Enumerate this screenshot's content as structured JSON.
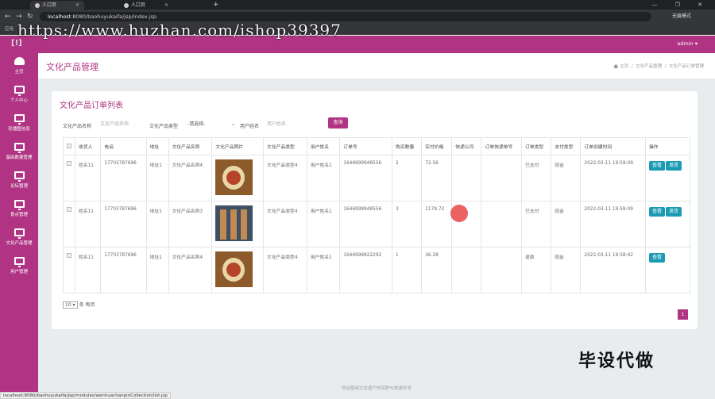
{
  "browser": {
    "tabs": [
      {
        "title": "人口页"
      },
      {
        "title": "人口页"
      }
    ],
    "url_host": "localhost",
    "url_rest": ":8080/baohuyukaifa/jsp/index.jsp",
    "profile": "无痕模式",
    "window_controls": "— ❐ ✕",
    "bookmarks": [
      "应用",
      "",
      "",
      "",
      ""
    ]
  },
  "watermark": "https://www.huzhan.com/ishop39397",
  "app": {
    "logo": "[!]",
    "user": "admin ▾"
  },
  "sidebar": {
    "items": [
      {
        "label": "主页",
        "icon": "gauge-icon"
      },
      {
        "label": "个人中心",
        "icon": "monitor-icon"
      },
      {
        "label": "轮播图信息",
        "icon": "monitor-icon"
      },
      {
        "label": "基础数据管理",
        "icon": "monitor-icon"
      },
      {
        "label": "论坛管理",
        "icon": "monitor-icon"
      },
      {
        "label": "景点管理",
        "icon": "monitor-icon"
      },
      {
        "label": "文化产品管理",
        "icon": "monitor-icon"
      },
      {
        "label": "用户管理",
        "icon": "monitor-icon"
      }
    ]
  },
  "page": {
    "title": "文化产品管理",
    "breadcrumb": [
      "主页",
      "文化产品管理",
      "文化产品订单管理"
    ]
  },
  "card": {
    "title": "文化产品订单列表",
    "filters": {
      "name_label": "文化产品名称",
      "name_placeholder": "文化产品名称",
      "type_label": "文化产品类型",
      "type_value": "-请选择-",
      "user_label": "用户姓名",
      "user_placeholder": "用户姓名",
      "search_button": "查询"
    },
    "table": {
      "headers": [
        "",
        "收货人",
        "电话",
        "地址",
        "文化产品名称",
        "文化产品照片",
        "文化产品类型",
        "用户姓名",
        "订单号",
        "购买数量",
        "实付价格",
        "快递公司",
        "订单快递单号",
        "订单类型",
        "支付类型",
        "订单创建时间",
        "操作"
      ],
      "rows": [
        {
          "receiver": "姓名11",
          "phone": "17703787696",
          "address": "地址1",
          "product": "文化产品名称4",
          "photo": "medal",
          "type": "文化产品类型4",
          "user": "用户姓名1",
          "order_no": "1646999948556",
          "qty": "2",
          "price": "72.56",
          "courier": "",
          "tracking": "",
          "order_type": "已支付",
          "pay_type": "现金",
          "created": "2022-03-11 19:59:09",
          "actions": [
            "查看",
            "发货"
          ]
        },
        {
          "receiver": "姓名11",
          "phone": "17703787696",
          "address": "地址1",
          "product": "文化产品名称3",
          "photo": "sticks",
          "type": "文化产品类型4",
          "user": "用户姓名1",
          "order_no": "1646999948556",
          "qty": "3",
          "price": "1179.72",
          "courier": "",
          "tracking": "",
          "order_type": "已支付",
          "pay_type": "现金",
          "created": "2022-03-11 19:59:09",
          "actions": [
            "查看",
            "发货"
          ]
        },
        {
          "receiver": "姓名11",
          "phone": "17703787696",
          "address": "地址1",
          "product": "文化产品名称4",
          "photo": "medal",
          "type": "文化产品类型4",
          "user": "用户姓名1",
          "order_no": "1646999922292",
          "qty": "1",
          "price": "36.28",
          "courier": "",
          "tracking": "",
          "order_type": "退款",
          "pay_type": "现金",
          "created": "2022-03-11 19:58:42",
          "actions": [
            "查看"
          ]
        }
      ]
    },
    "pager": {
      "page_size": "10 ▾",
      "page_size_suffix": "条 每页",
      "current_page": "1"
    }
  },
  "footer": "欢迎使用文化遗产的保护与旅游开发",
  "statusbar": "localhost:8080/baohuyukaifa/jsp/modules/wenhuachanpinCollection/list.jsp",
  "caption": "毕设代做"
}
